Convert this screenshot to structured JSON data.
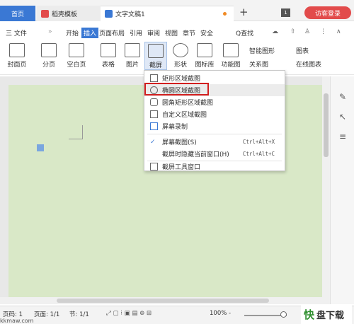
{
  "tabs": {
    "home": "首页",
    "template": "稻壳模板",
    "document": "文字文稿1",
    "add": "+",
    "visitor": "访客登录"
  },
  "menu": {
    "file": "三 文件",
    "start": "开始",
    "insert": "插入",
    "layout": "页面布局",
    "reference": "引用",
    "review": "审阅",
    "view": "视图",
    "chapter": "章节",
    "security": "安全",
    "search": "Q查找"
  },
  "ribbon": {
    "cover": "封面页",
    "section": "分页",
    "blank": "空白页",
    "table": "表格",
    "picture": "图片",
    "screenshot": "截屏",
    "shape": "形状",
    "iconlib": "图标库",
    "functions": "功能图",
    "smart": "智能图形",
    "chart": "图表",
    "relation": "关系图",
    "online": "在线图表"
  },
  "screenshot_menu": {
    "items": [
      {
        "label": "矩形区域截图",
        "shortcut": ""
      },
      {
        "label": "椭圆区域截图",
        "shortcut": ""
      },
      {
        "label": "圆角矩形区域截图",
        "shortcut": ""
      },
      {
        "label": "自定义区域截图",
        "shortcut": ""
      },
      {
        "label": "屏幕录制",
        "shortcut": ""
      },
      {
        "label": "屏幕截图(S)",
        "shortcut": "Ctrl+Alt+X"
      },
      {
        "label": "截屏时隐藏当前窗口(H)",
        "shortcut": "Ctrl+Alt+C"
      },
      {
        "label": "截屏工具窗口",
        "shortcut": ""
      }
    ]
  },
  "status": {
    "page_no": "页码: 1",
    "page_total": "页面: 1/1",
    "section": "节: 1/1",
    "zoom": "100% -",
    "watermark": "kkmaw.com"
  },
  "colors": {
    "accent": "#3a78d4",
    "visitor": "#e24b4b",
    "page_bg": "#d9e8c7",
    "highlight_box": "#d21f1f"
  }
}
